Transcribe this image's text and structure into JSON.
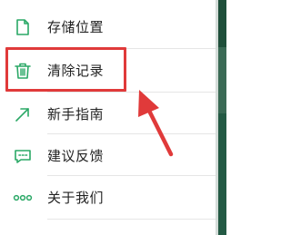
{
  "menu": {
    "items": [
      {
        "label": "存储位置",
        "icon": "document-icon"
      },
      {
        "label": "清除记录",
        "icon": "trash-icon"
      },
      {
        "label": "新手指南",
        "icon": "arrow-up-right-icon"
      },
      {
        "label": "建议反馈",
        "icon": "feedback-message-icon"
      },
      {
        "label": "关于我们",
        "icon": "more-dots-icon"
      }
    ]
  },
  "colors": {
    "icon_green": "#2aa866",
    "highlight_red": "#e03a3a",
    "text": "#222222"
  }
}
